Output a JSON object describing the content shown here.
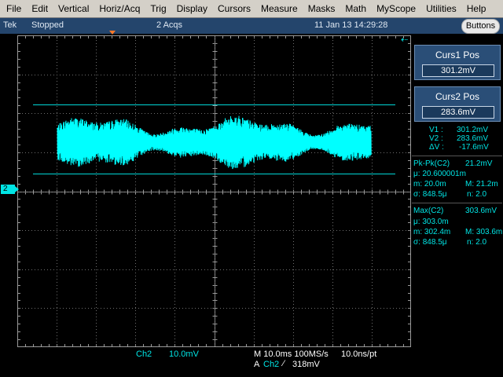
{
  "menu": [
    "File",
    "Edit",
    "Vertical",
    "Horiz/Acq",
    "Trig",
    "Display",
    "Cursors",
    "Measure",
    "Masks",
    "Math",
    "MyScope",
    "Utilities",
    "Help"
  ],
  "status": {
    "brand": "Tek",
    "state": "Stopped",
    "acquisitions": "2 Acqs",
    "datetime": "11 Jan 13  14:29:28",
    "buttons_label": "Buttons"
  },
  "channel": {
    "marker": "2",
    "color": "#00e5e5"
  },
  "cursors": {
    "curs1_label": "Curs1 Pos",
    "curs1_value": "301.2mV",
    "curs2_label": "Curs2 Pos",
    "curs2_value": "283.6mV",
    "v1_label": "V1 :",
    "v1_value": "301.2mV",
    "v2_label": "V2 :",
    "v2_value": "283.6mV",
    "dv_label": "ΔV :",
    "dv_value": "-17.6mV"
  },
  "measurements": [
    {
      "name": "Pk-Pk(C2)",
      "value": "21.2mV",
      "mean": "μ: 20.600001m",
      "min": "m: 20.0m",
      "max": "M: 21.2m",
      "sigma": "σ: 848.5μ",
      "n": "n: 2.0"
    },
    {
      "name": "Max(C2)",
      "value": "303.6mV",
      "mean": "μ: 303.0m",
      "min": "m: 302.4m",
      "max": "M: 303.6m",
      "sigma": "σ: 848.5μ",
      "n": "n: 2.0"
    }
  ],
  "bottom": {
    "ch_name": "Ch2",
    "ch_scale": "10.0mV",
    "timebase": "M 10.0ms 100MS/s",
    "sample_interval": "10.0ns/pt",
    "trig_prefix": "A",
    "trig_source": "Ch2",
    "trig_slope_icon": "rising-edge-icon",
    "trig_level": "318mV"
  }
}
